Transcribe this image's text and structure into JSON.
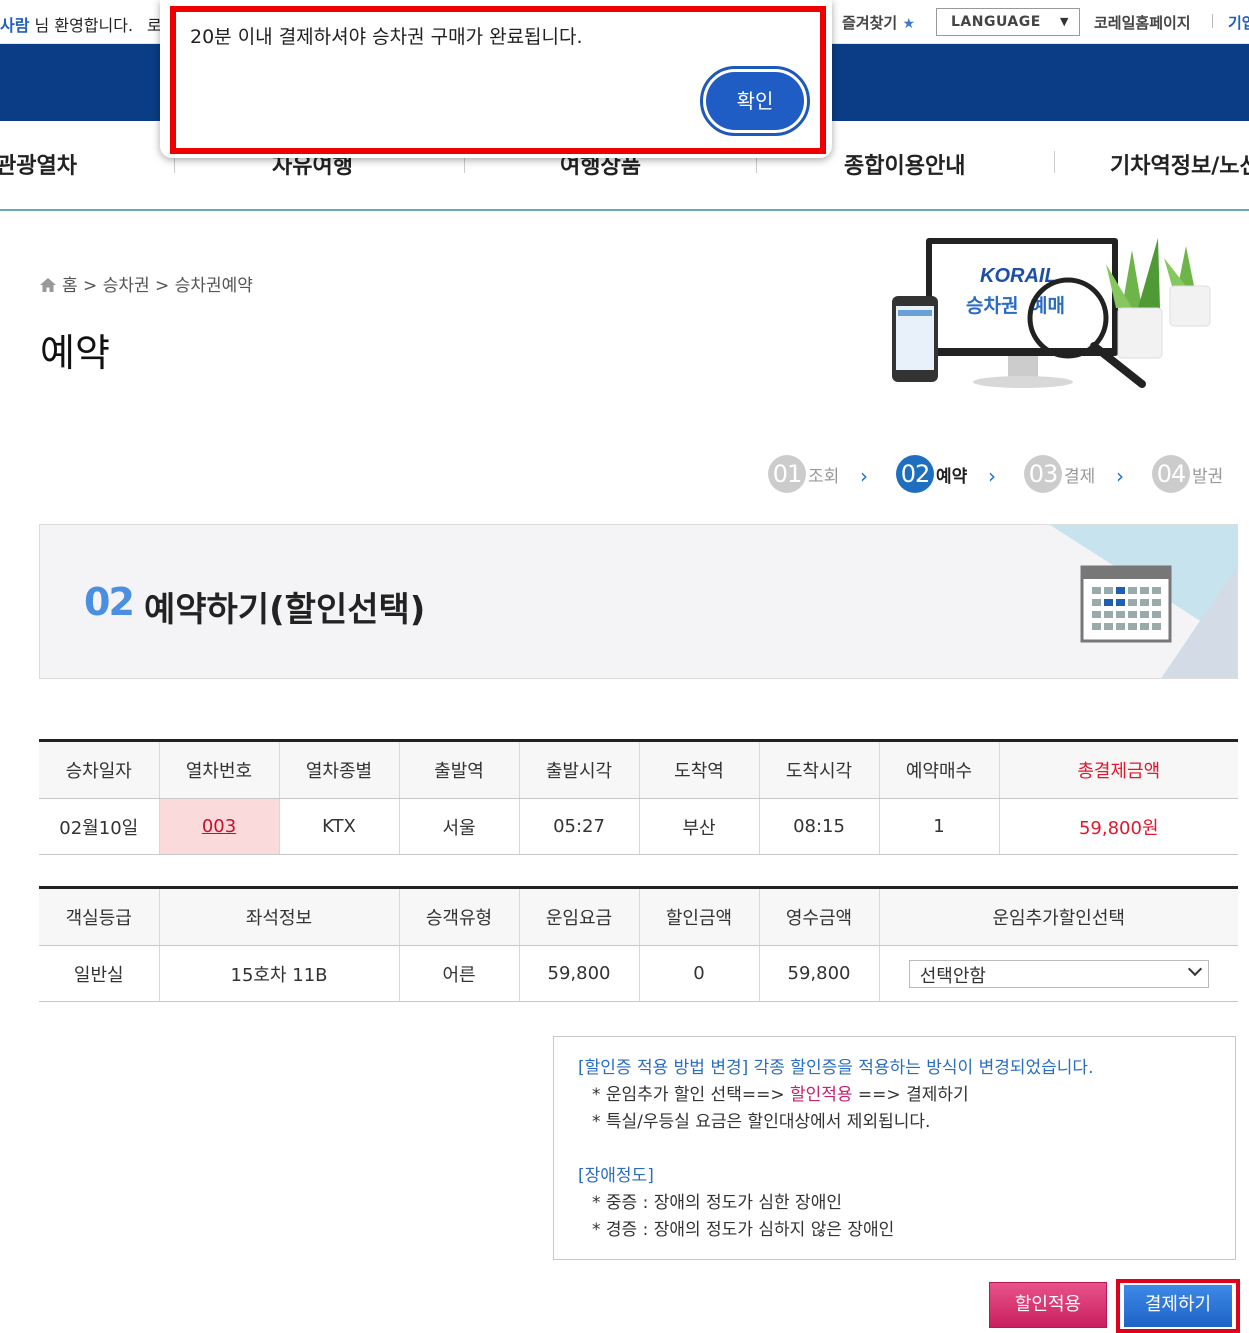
{
  "topbar": {
    "user_name": "사람",
    "welcome_text": " 님 환영합니다.",
    "logout": "로",
    "favorites": "즐겨찾기",
    "language": "LANGUAGE",
    "korail_home": "코레일홈페이지",
    "business": "기업"
  },
  "nav": {
    "items": [
      "관광열차",
      "자유여행",
      "여행상품",
      "종합이용안내",
      "기차역정보/노선"
    ]
  },
  "breadcrumb": {
    "home": "홈",
    "level1": "승차권",
    "level2": "승차권예약"
  },
  "page_title": "예약",
  "hero": {
    "brand": "KORAIL",
    "caption_a": "승차권",
    "caption_b": "예매"
  },
  "steps": [
    {
      "num": "01",
      "label": "조회"
    },
    {
      "num": "02",
      "label": "예약"
    },
    {
      "num": "03",
      "label": "결제"
    },
    {
      "num": "04",
      "label": "발권"
    }
  ],
  "banner": {
    "num": "02",
    "title": "예약하기(할인선택)"
  },
  "trip_table": {
    "headers": [
      "승차일자",
      "열차번호",
      "열차종별",
      "출발역",
      "출발시각",
      "도착역",
      "도착시각",
      "예약매수",
      "총결제금액"
    ],
    "row": [
      "02월10일",
      "003",
      "KTX",
      "서울",
      "05:27",
      "부산",
      "08:15",
      "1",
      "59,800원"
    ]
  },
  "fare_table": {
    "headers": [
      "객실등급",
      "좌석정보",
      "승객유형",
      "운임요금",
      "할인금액",
      "영수금액",
      "운임추가할인선택"
    ],
    "row": [
      "일반실",
      "15호차 11B",
      "어른",
      "59,800",
      "0",
      "59,800"
    ],
    "discount_select": "선택안함"
  },
  "notice": {
    "head1": "[할인증 적용 방법 변경]",
    "text1": " 각종 할인증을 적용하는 방식이 변경되었습니다.",
    "line2_a": "* 운임추가 할인 선택==> ",
    "line2_b": "할인적용",
    "line2_c": " ==> 결제하기",
    "line3": "* 특실/우등실 요금은 할인대상에서 제외됩니다.",
    "head2": "[장애정도]",
    "line5": "* 중증 : 장애의 정도가 심한 장애인",
    "line6": "* 경증 : 장애의 정도가 심하지 않은 장애인"
  },
  "buttons": {
    "discount": "할인적용",
    "pay": "결제하기"
  },
  "modal": {
    "message": "20분 이내 결제하셔야 승차권 구매가 완료됩니다.",
    "confirm": "확인"
  },
  "colors": {
    "header_blue": "#0b3d86",
    "accent_red": "#e0182b",
    "step_active": "#1e6fc0",
    "discount_pink": "#c8205e"
  }
}
